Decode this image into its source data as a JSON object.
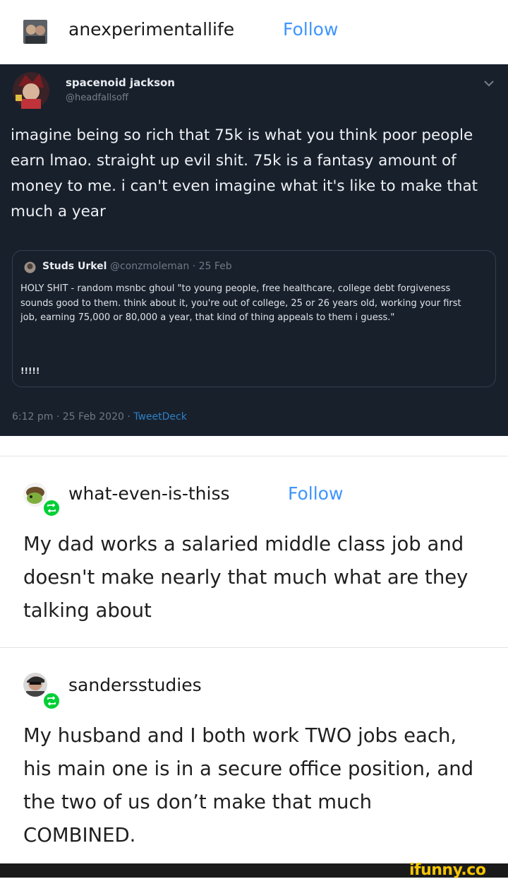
{
  "post1": {
    "username": "anexperimentallife",
    "follow_label": "Follow"
  },
  "tweet": {
    "author_name": "spacenoid jackson",
    "author_handle": "@headfallsoff",
    "text": "imagine being so rich that 75k is what you think poor people earn lmao. straight up evil shit. 75k is a fantasy amount of money to me. i can't even imagine what it's like to make that much a year",
    "quoted": {
      "author_name": "Studs Urkel",
      "meta": "@conzmoleman · 25 Feb",
      "text": "HOLY SHIT - random msnbc ghoul \"to young people, free healthcare, college debt forgiveness sounds good to them. think about it, you're out of college, 25 or 26 years old, working your first job, earning 75,000 or 80,000 a year, that kind of thing appeals to them i guess.\"",
      "exclaim": "!!!!!"
    },
    "timestamp": "6:12 pm · 25 Feb 2020 · ",
    "source": "TweetDeck"
  },
  "reblog1": {
    "username": "what-even-is-thiss",
    "follow_label": "Follow",
    "text": "My dad works a salaried middle class job and doesn't make nearly that much what are they talking about"
  },
  "reblog2": {
    "username": "sandersstudies",
    "text": "My husband and I both work TWO jobs each, his main one is in a secure office position, and the two of us don’t make that much COMBINED."
  },
  "watermark": "ifunny.co",
  "colors": {
    "follow": "#3f95ff",
    "tweet_bg": "#18202c",
    "reblog_badge": "#00cf35",
    "watermark": "#f5c400"
  },
  "icons": {
    "reblog": "reblog-icon",
    "tweet_menu": "chevron-down-icon"
  }
}
